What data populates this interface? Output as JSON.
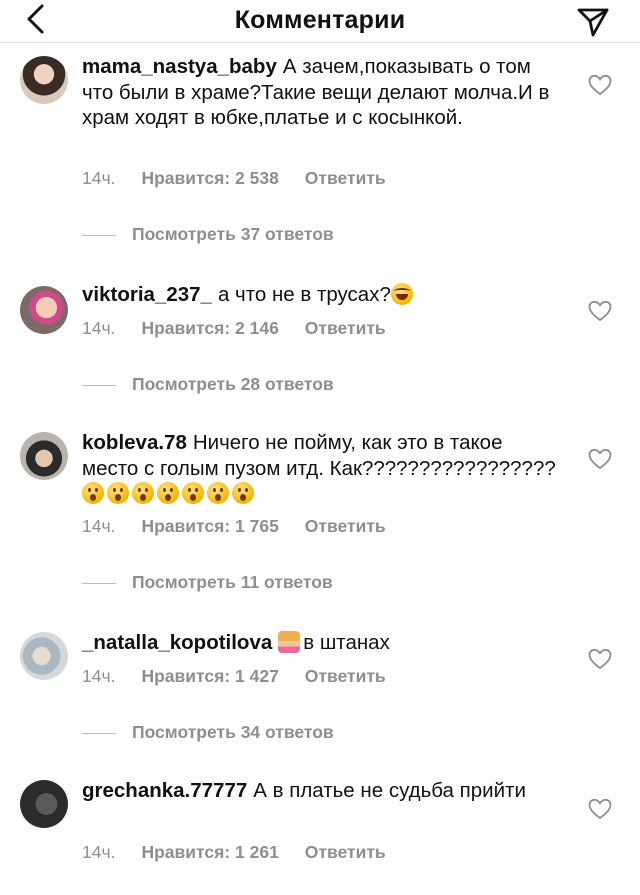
{
  "header": {
    "title": "Комментарии",
    "back_icon": "chevron-left-icon",
    "send_icon": "paper-plane-icon"
  },
  "comments": [
    {
      "username": "mama_nastya_baby",
      "text": "А зачем,показывать о том что были в храме?Такие вещи делают молча.И в храм ходят в юбке,платье и с косынкой.",
      "time": "14ч.",
      "likes": "Нравится: 2 538",
      "reply": "Ответить",
      "replies": "Посмотреть 37 ответов"
    },
    {
      "username": "viktoria_237_",
      "text": "а что не в трусах?",
      "time": "14ч.",
      "likes": "Нравится: 2 146",
      "reply": "Ответить",
      "replies": "Посмотреть 28 ответов"
    },
    {
      "username": "kobleva.78",
      "text": "Ничего не пойму, как это в такое место с голым пузом  итд. Как?????????????????",
      "time": "14ч.",
      "likes": "Нравится: 1 765",
      "reply": "Ответить",
      "replies": "Посмотреть 11 ответов"
    },
    {
      "username": "_natalla_kopotilova",
      "text": "в штанах",
      "time": "14ч.",
      "likes": "Нравится: 1 427",
      "reply": "Ответить",
      "replies": "Посмотреть 34 ответов"
    },
    {
      "username": "grechanka.77777",
      "text": "А в платье не судьба прийти",
      "time": "14ч.",
      "likes": "Нравится: 1 261",
      "reply": "Ответить"
    }
  ],
  "colors": {
    "text": "#111111",
    "muted": "#8e8e8e",
    "divider": "#e3e3e3"
  }
}
